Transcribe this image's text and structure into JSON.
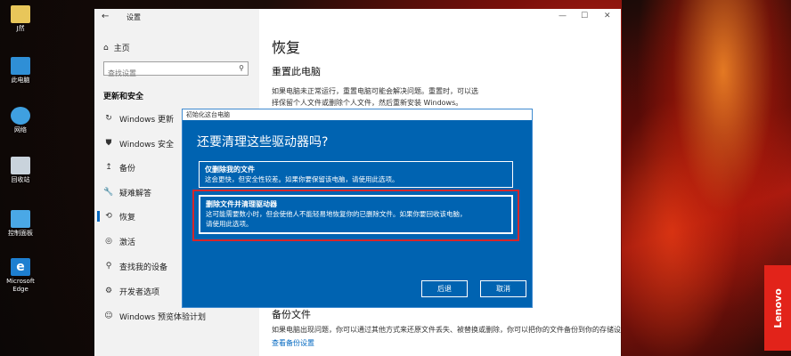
{
  "desktop": {
    "icons": [
      {
        "label": "J然",
        "icon": "user-folder-icon"
      },
      {
        "label": "此电脑",
        "icon": "computer-icon"
      },
      {
        "label": "网络",
        "icon": "network-icon"
      },
      {
        "label": "回收站",
        "icon": "recycle-bin-icon"
      },
      {
        "label": "控制面板",
        "icon": "control-panel-icon"
      },
      {
        "label": "Microsoft Edge",
        "icon": "edge-icon"
      }
    ],
    "brand": "Lenovo"
  },
  "window": {
    "title": "设置",
    "back": "←",
    "minimize": "—",
    "maximize": "☐",
    "close": "✕"
  },
  "sidebar": {
    "home": "主页",
    "search_placeholder": "查找设置",
    "section": "更新和安全",
    "items": [
      {
        "label": "Windows 更新",
        "icon": "↻"
      },
      {
        "label": "Windows 安全",
        "icon": "⛊"
      },
      {
        "label": "备份",
        "icon": "↥"
      },
      {
        "label": "疑难解答",
        "icon": "🔧"
      },
      {
        "label": "恢复",
        "icon": "⟲"
      },
      {
        "label": "激活",
        "icon": "◎"
      },
      {
        "label": "查找我的设备",
        "icon": "⚲"
      },
      {
        "label": "开发者选项",
        "icon": "⚙"
      },
      {
        "label": "Windows 预览体验计划",
        "icon": "☺"
      }
    ]
  },
  "main": {
    "title": "恢复",
    "reset_heading": "重置此电脑",
    "reset_text_1": "如果电脑未正常运行，重置电脑可能会解决问题。重置时，可以选",
    "reset_text_2": "择保留个人文件或删除个人文件，然后重新安装 Windows。",
    "backup_heading": "备份文件",
    "backup_text": "如果电脑出现问题，你可以通过其他方式来还原文件丢失、被替换或删除，你可以把你的文件备份到你的存储设备",
    "backup_link": "查看备份设置"
  },
  "dialog": {
    "titlebar": "初始化这台电脑",
    "question": "还要清理这些驱动器吗?",
    "option1": {
      "title": "仅删除我的文件",
      "desc": "这会更快，但安全性较差。如果你要保留该电脑，请使用此选项。"
    },
    "option2": {
      "title": "删除文件并清理驱动器",
      "desc1": "这可能需要数小时，但会使他人不能轻易地恢复你的已删除文件。如果你要回收该电脑，",
      "desc2": "请使用此选项。"
    },
    "back_button": "后退",
    "cancel_button": "取消"
  },
  "colors": {
    "dialog_bg": "#0063b1",
    "highlight": "#d6262b",
    "accent": "#0067c0"
  }
}
